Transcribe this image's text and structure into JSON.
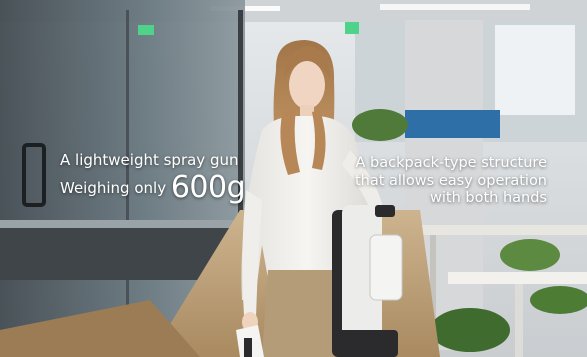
{
  "captions": {
    "left": {
      "line1": "A lightweight spray gun",
      "line2_prefix": "Weighing only ",
      "line2_value": "600g"
    },
    "right": {
      "line1": "A backpack-type structure",
      "line2": "that allows easy operation",
      "line3": "with both hands"
    }
  },
  "colors": {
    "caption_text": "#ffffff",
    "wall": "#d9dde0",
    "floor": "#b79a73",
    "glass": "#5b6a72",
    "shirt": "#f1f0ec",
    "skirt": "#b59c79",
    "hair": "#b98a5c",
    "backpack_white": "#ececea",
    "backpack_dark": "#2b2b2d"
  }
}
